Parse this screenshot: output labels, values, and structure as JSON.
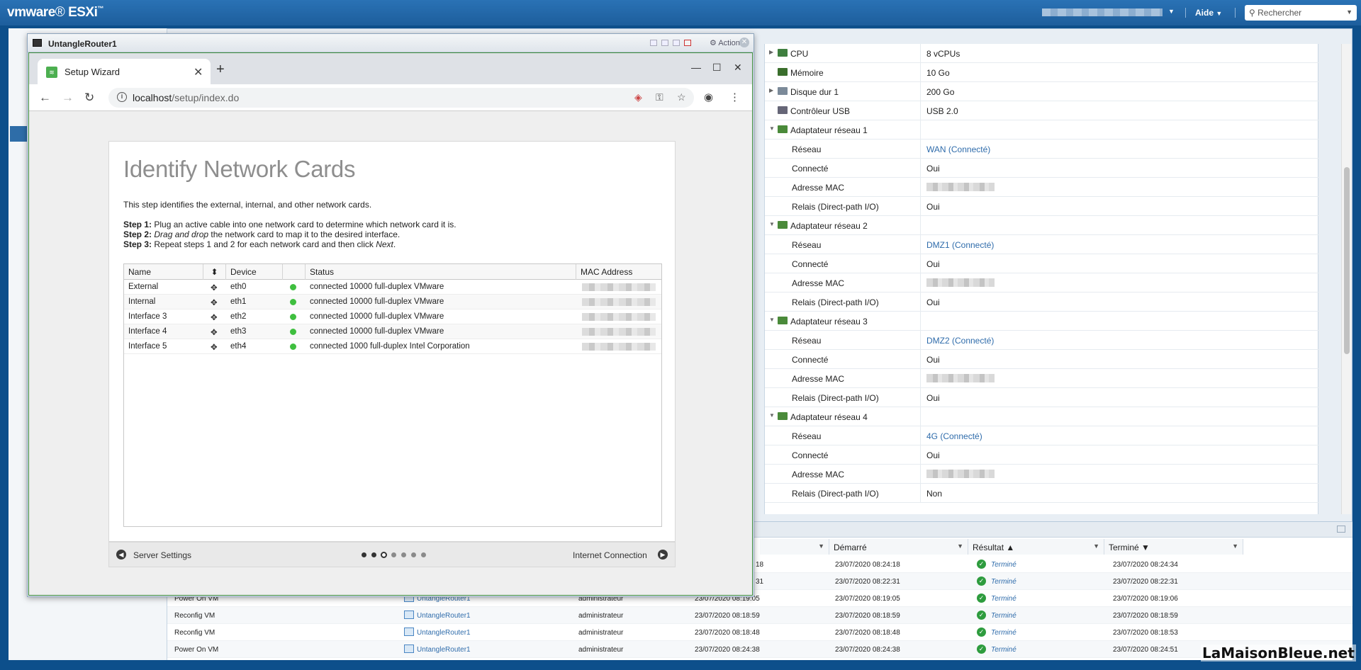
{
  "esxi": {
    "logo_brand": "vmware",
    "logo_product": "ESXi",
    "help": "Aide",
    "search_placeholder": "Rechercher"
  },
  "vm_window": {
    "title": "UntangleRouter1",
    "actions": "Actions"
  },
  "browser": {
    "tab_title": "Setup Wizard",
    "url_host": "localhost",
    "url_path": "/setup/index.do"
  },
  "wizard": {
    "title": "Identify Network Cards",
    "intro": "This step identifies the external, internal, and other network cards.",
    "step1_label": "Step 1:",
    "step1_text": " Plug an active cable into one network card to determine which network card it is.",
    "step2_label": "Step 2:",
    "step2_em": "Drag and drop",
    "step2_text": " the network card to map it to the desired interface.",
    "step3_label": "Step 3:",
    "step3_text": " Repeat steps 1 and 2 for each network card and then click ",
    "step3_em": "Next",
    "step3_end": ".",
    "columns": [
      "Name",
      "Device",
      "Status",
      "MAC Address"
    ],
    "rows": [
      {
        "name": "External",
        "device": "eth0",
        "status": "connected 10000 full-duplex VMware"
      },
      {
        "name": "Internal",
        "device": "eth1",
        "status": "connected 10000 full-duplex VMware"
      },
      {
        "name": "Interface 3",
        "device": "eth2",
        "status": "connected 10000 full-duplex VMware"
      },
      {
        "name": "Interface 4",
        "device": "eth3",
        "status": "connected 10000 full-duplex VMware"
      },
      {
        "name": "Interface 5",
        "device": "eth4",
        "status": "connected 1000 full-duplex Intel Corporation"
      }
    ],
    "prev_label": "Server Settings",
    "next_label": "Internet Connection",
    "progress": {
      "total": 7,
      "current_index": 2
    }
  },
  "vm_details": [
    {
      "label": "CPU",
      "value": "8 vCPUs",
      "level": 0,
      "expander": "right",
      "link": false
    },
    {
      "label": "Mémoire",
      "value": "10 Go",
      "level": 0,
      "expander": "",
      "link": false
    },
    {
      "label": "Disque dur 1",
      "value": "200 Go",
      "level": 0,
      "expander": "right",
      "link": false
    },
    {
      "label": "Contrôleur USB",
      "value": "USB 2.0",
      "level": 0,
      "expander": "",
      "link": false
    },
    {
      "label": "Adaptateur réseau 1",
      "value": "",
      "level": 0,
      "expander": "down",
      "link": false
    },
    {
      "label": "Réseau",
      "value": "WAN (Connecté)",
      "level": 1,
      "expander": "",
      "link": true
    },
    {
      "label": "Connecté",
      "value": "Oui",
      "level": 1,
      "expander": "",
      "link": false
    },
    {
      "label": "Adresse MAC",
      "value": "",
      "level": 1,
      "expander": "",
      "link": false,
      "blurred": true
    },
    {
      "label": "Relais (Direct-path I/O)",
      "value": "Oui",
      "level": 1,
      "expander": "",
      "link": false
    },
    {
      "label": "Adaptateur réseau 2",
      "value": "",
      "level": 0,
      "expander": "down",
      "link": false
    },
    {
      "label": "Réseau",
      "value": "DMZ1 (Connecté)",
      "level": 1,
      "expander": "",
      "link": true
    },
    {
      "label": "Connecté",
      "value": "Oui",
      "level": 1,
      "expander": "",
      "link": false
    },
    {
      "label": "Adresse MAC",
      "value": "",
      "level": 1,
      "expander": "",
      "link": false,
      "blurred": true
    },
    {
      "label": "Relais (Direct-path I/O)",
      "value": "Oui",
      "level": 1,
      "expander": "",
      "link": false
    },
    {
      "label": "Adaptateur réseau 3",
      "value": "",
      "level": 0,
      "expander": "down",
      "link": false
    },
    {
      "label": "Réseau",
      "value": "DMZ2 (Connecté)",
      "level": 1,
      "expander": "",
      "link": true
    },
    {
      "label": "Connecté",
      "value": "Oui",
      "level": 1,
      "expander": "",
      "link": false
    },
    {
      "label": "Adresse MAC",
      "value": "",
      "level": 1,
      "expander": "",
      "link": false,
      "blurred": true
    },
    {
      "label": "Relais (Direct-path I/O)",
      "value": "Oui",
      "level": 1,
      "expander": "",
      "link": false
    },
    {
      "label": "Adaptateur réseau 4",
      "value": "",
      "level": 0,
      "expander": "down",
      "link": false
    },
    {
      "label": "Réseau",
      "value": "4G (Connecté)",
      "level": 1,
      "expander": "",
      "link": true
    },
    {
      "label": "Connecté",
      "value": "Oui",
      "level": 1,
      "expander": "",
      "link": false
    },
    {
      "label": "Adresse MAC",
      "value": "",
      "level": 1,
      "expander": "",
      "link": false,
      "blurred": true
    },
    {
      "label": "Relais (Direct-path I/O)",
      "value": "Non",
      "level": 1,
      "expander": "",
      "link": false
    }
  ],
  "tasks": {
    "columns": [
      "Démarré",
      "Résultat ▲",
      "Terminé ▼"
    ],
    "rows": [
      {
        "task": "",
        "target": "",
        "initiator": "",
        "queued": "18",
        "started": "23/07/2020 08:24:18",
        "result": "Terminé",
        "completed": "23/07/2020 08:24:34"
      },
      {
        "task": "",
        "target": "",
        "initiator": "",
        "queued": "31",
        "started": "23/07/2020 08:22:31",
        "result": "Terminé",
        "completed": "23/07/2020 08:22:31"
      },
      {
        "task": "Power On VM",
        "target": "UntangleRouter1",
        "initiator": "administrateur",
        "queued": "23/07/2020 08:19:05",
        "started": "23/07/2020 08:19:05",
        "result": "Terminé",
        "completed": "23/07/2020 08:19:06"
      },
      {
        "task": "Reconfig VM",
        "target": "UntangleRouter1",
        "initiator": "administrateur",
        "queued": "23/07/2020 08:18:59",
        "started": "23/07/2020 08:18:59",
        "result": "Terminé",
        "completed": "23/07/2020 08:18:59"
      },
      {
        "task": "Reconfig VM",
        "target": "UntangleRouter1",
        "initiator": "administrateur",
        "queued": "23/07/2020 08:18:48",
        "started": "23/07/2020 08:18:48",
        "result": "Terminé",
        "completed": "23/07/2020 08:18:53"
      },
      {
        "task": "Power On VM",
        "target": "UntangleRouter1",
        "initiator": "administrateur",
        "queued": "23/07/2020 08:24:38",
        "started": "23/07/2020 08:24:38",
        "result": "Terminé",
        "completed": "23/07/2020 08:24:51"
      }
    ]
  },
  "watermark": "LaMaisonBleue.net",
  "colors": {
    "esxi_blue": "#1d5e9c",
    "link": "#2f6cab",
    "status_green": "#3fbf3f",
    "ok_green": "#2e9c3e"
  }
}
